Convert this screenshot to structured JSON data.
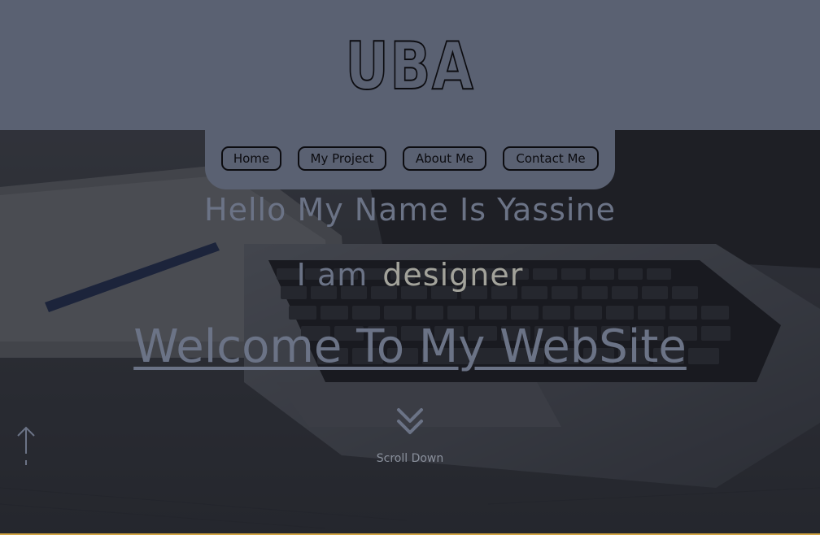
{
  "header": {
    "logo": "UBA",
    "nav": [
      {
        "label": "Home"
      },
      {
        "label": "My Project"
      },
      {
        "label": "About Me"
      },
      {
        "label": "Contact Me"
      }
    ]
  },
  "hero": {
    "greeting": "Hello My Name Is Yassine",
    "role_prefix": "I am",
    "role": "designer",
    "welcome_link": "Welcome To My WebSite",
    "scroll_label": "Scroll Down"
  },
  "icons": {
    "scroll": "double-chevron-down-icon",
    "back_to_top": "arrow-up-icon"
  },
  "colors": {
    "header_bg": "#5a6172",
    "text_muted": "#6b7386",
    "role_text": "#a3a39b",
    "outline": "#0c0c10"
  }
}
